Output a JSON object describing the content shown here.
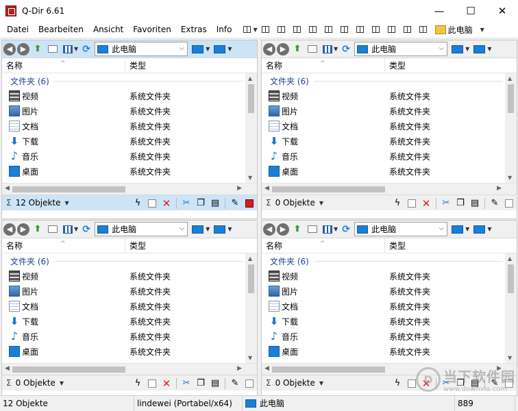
{
  "window": {
    "title": "Q-Dir 6.61",
    "minimize": "—",
    "maximize": "☐",
    "close": "✕"
  },
  "menu": {
    "items": [
      "Datei",
      "Bearbeiten",
      "Ansicht",
      "Favoriten",
      "Extras",
      "Info"
    ],
    "pc_label": "此电脑"
  },
  "icons": [
    "back-icon",
    "forward-icon",
    "up-icon",
    "folder-icon",
    "view-icon",
    "refresh-icon",
    "computer-icon",
    "video-icon",
    "image-icon",
    "document-icon",
    "download-icon",
    "music-icon",
    "desktop-icon",
    "lightning-icon",
    "email-icon",
    "delete-icon",
    "cut-icon",
    "copy-icon",
    "paste-icon",
    "edit-icon",
    "stop-icon"
  ],
  "colors": {
    "active_pane": "#cde4f7",
    "group_header": "#1e3f9a",
    "delete": "#e01b1b",
    "accent_blue": "#1a7fd8"
  },
  "panes": [
    {
      "address": "此电脑",
      "columns": {
        "name": "名称",
        "type": "类型"
      },
      "group": "文件夹 (6)",
      "rows": [
        {
          "name": "视频",
          "type": "系统文件夹"
        },
        {
          "name": "图片",
          "type": "系统文件夹"
        },
        {
          "name": "文档",
          "type": "系统文件夹"
        },
        {
          "name": "下载",
          "type": "系统文件夹"
        },
        {
          "name": "音乐",
          "type": "系统文件夹"
        },
        {
          "name": "桌面",
          "type": "系统文件夹"
        }
      ],
      "status": "12 Objekte"
    },
    {
      "address": "此电脑",
      "columns": {
        "name": "名称",
        "type": "类型"
      },
      "group": "文件夹 (6)",
      "rows": [
        {
          "name": "视频",
          "type": "系统文件夹"
        },
        {
          "name": "图片",
          "type": "系统文件夹"
        },
        {
          "name": "文档",
          "type": "系统文件夹"
        },
        {
          "name": "下载",
          "type": "系统文件夹"
        },
        {
          "name": "音乐",
          "type": "系统文件夹"
        },
        {
          "name": "桌面",
          "type": "系统文件夹"
        }
      ],
      "status": "0 Objekte"
    },
    {
      "address": "此电脑",
      "columns": {
        "name": "名称",
        "type": "类型"
      },
      "group": "文件夹 (6)",
      "rows": [
        {
          "name": "视频",
          "type": "系统文件夹"
        },
        {
          "name": "图片",
          "type": "系统文件夹"
        },
        {
          "name": "文档",
          "type": "系统文件夹"
        },
        {
          "name": "下载",
          "type": "系统文件夹"
        },
        {
          "name": "音乐",
          "type": "系统文件夹"
        },
        {
          "name": "桌面",
          "type": "系统文件夹"
        }
      ],
      "status": "0 Objekte"
    },
    {
      "address": "此电脑",
      "columns": {
        "name": "名称",
        "type": "类型"
      },
      "group": "文件夹 (6)",
      "rows": [
        {
          "name": "视频",
          "type": "系统文件夹"
        },
        {
          "name": "图片",
          "type": "系统文件夹"
        },
        {
          "name": "文档",
          "type": "系统文件夹"
        },
        {
          "name": "下载",
          "type": "系统文件夹"
        },
        {
          "name": "音乐",
          "type": "系统文件夹"
        },
        {
          "name": "桌面",
          "type": "系统文件夹"
        }
      ],
      "status": "0 Objekte"
    }
  ],
  "statusbar": {
    "objects": "12 Objekte",
    "user": "lindewei (Portabel/x64)",
    "location": "此电脑",
    "number": "889"
  },
  "watermark": {
    "main": "当下软件园",
    "sub": "www.downxia.com"
  }
}
